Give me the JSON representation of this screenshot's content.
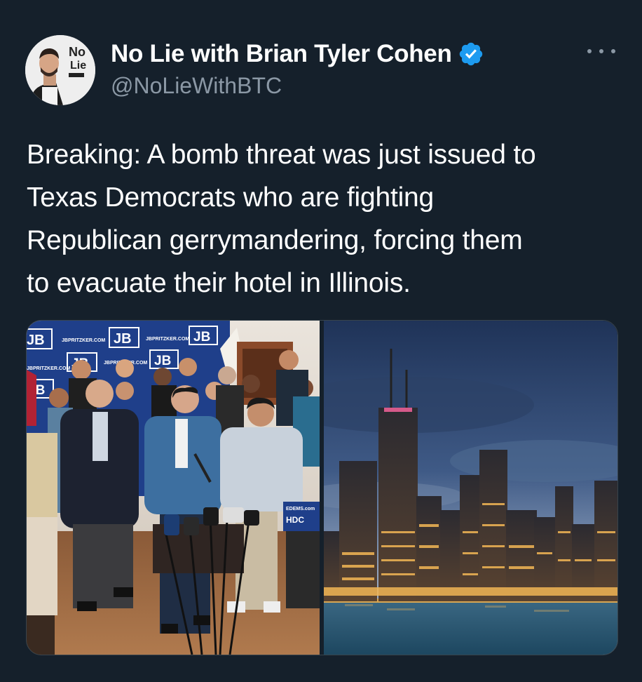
{
  "tweet": {
    "display_name": "No Lie with Brian Tyler Cohen",
    "handle": "@NoLieWithBTC",
    "verified": true,
    "text_lines": [
      "Breaking: A bomb threat was just issued to",
      "Texas Democrats who are fighting",
      "Republican gerrymandering, forcing them",
      "to evacuate their hotel in Illinois."
    ],
    "avatar_logo": {
      "line1": "No",
      "line2": "Lie"
    }
  },
  "media": {
    "left_image": {
      "icon": "press-conference-photo",
      "backdrop_logo": "JB",
      "backdrop_url": "JBPRITZKER.COM",
      "podium_sign": "HDC",
      "podium_url": "EDEMS.com"
    },
    "right_image": {
      "icon": "chicago-skyline-photo"
    }
  },
  "colors": {
    "background": "#15202b",
    "text_primary": "#ffffff",
    "text_secondary": "#8b98a5",
    "verified_blue": "#1d9bf0",
    "border": "#38444d"
  },
  "icons": {
    "verified": "verified-badge-icon",
    "more": "more-options-icon"
  }
}
